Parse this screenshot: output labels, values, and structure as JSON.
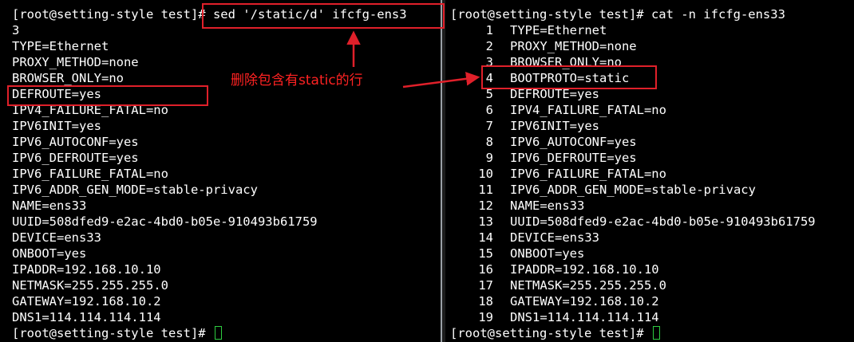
{
  "left_terminal": {
    "command_line": "[root@setting-style test]# sed '/static/d' ifcfg-ens3",
    "output": [
      "3",
      "TYPE=Ethernet",
      "PROXY_METHOD=none",
      "BROWSER_ONLY=no",
      "DEFROUTE=yes",
      "IPV4_FAILURE_FATAL=no",
      "IPV6INIT=yes",
      "IPV6_AUTOCONF=yes",
      "IPV6_DEFROUTE=yes",
      "IPV6_FAILURE_FATAL=no",
      "IPV6_ADDR_GEN_MODE=stable-privacy",
      "NAME=ens33",
      "UUID=508dfed9-e2ac-4bd0-b05e-910493b61759",
      "DEVICE=ens33",
      "ONBOOT=yes",
      "IPADDR=192.168.10.10",
      "NETMASK=255.255.255.0",
      "GATEWAY=192.168.10.2",
      "DNS1=114.114.114.114"
    ],
    "prompt": "[root@setting-style test]# "
  },
  "right_terminal": {
    "command_line": "[root@setting-style test]# cat -n ifcfg-ens33",
    "numbered_output": [
      {
        "n": "1",
        "text": "TYPE=Ethernet"
      },
      {
        "n": "2",
        "text": "PROXY_METHOD=none"
      },
      {
        "n": "3",
        "text": "BROWSER_ONLY=no"
      },
      {
        "n": "4",
        "text": "BOOTPROTO=static"
      },
      {
        "n": "5",
        "text": "DEFROUTE=yes"
      },
      {
        "n": "6",
        "text": "IPV4_FAILURE_FATAL=no"
      },
      {
        "n": "7",
        "text": "IPV6INIT=yes"
      },
      {
        "n": "8",
        "text": "IPV6_AUTOCONF=yes"
      },
      {
        "n": "9",
        "text": "IPV6_DEFROUTE=yes"
      },
      {
        "n": "10",
        "text": "IPV6_FAILURE_FATAL=no"
      },
      {
        "n": "11",
        "text": "IPV6_ADDR_GEN_MODE=stable-privacy"
      },
      {
        "n": "12",
        "text": "NAME=ens33"
      },
      {
        "n": "13",
        "text": "UUID=508dfed9-e2ac-4bd0-b05e-910493b61759"
      },
      {
        "n": "14",
        "text": "DEVICE=ens33"
      },
      {
        "n": "15",
        "text": "ONBOOT=yes"
      },
      {
        "n": "16",
        "text": "IPADDR=192.168.10.10"
      },
      {
        "n": "17",
        "text": "NETMASK=255.255.255.0"
      },
      {
        "n": "18",
        "text": "GATEWAY=192.168.10.2"
      },
      {
        "n": "19",
        "text": "DNS1=114.114.114.114"
      }
    ],
    "prompt": "[root@setting-style test]# "
  },
  "annotation": {
    "label": "删除包含有static的行",
    "color": "#e0202a"
  },
  "colors": {
    "terminal_bg": "#000000",
    "terminal_fg": "#ffffff",
    "cursor": "#2ecc40",
    "divider": "#9aa0a6"
  },
  "icons": [
    "terminal-cursor-icon",
    "arrow-icon"
  ]
}
